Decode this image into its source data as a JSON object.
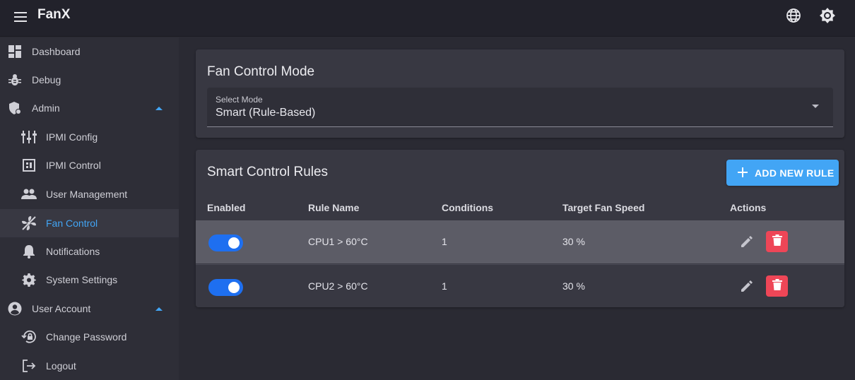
{
  "app": {
    "title": "FanX"
  },
  "topbar": {
    "icons": [
      "menu-icon",
      "globe-icon",
      "theme-brightness-icon"
    ]
  },
  "sidebar": {
    "items": [
      {
        "label": "Dashboard",
        "icon": "dashboard-icon"
      },
      {
        "label": "Debug",
        "icon": "bug-icon"
      },
      {
        "label": "Admin",
        "icon": "admin-shield-icon",
        "expanded": true
      },
      {
        "label": "IPMI Config",
        "icon": "sliders-icon"
      },
      {
        "label": "IPMI Control",
        "icon": "chip-icon"
      },
      {
        "label": "User Management",
        "icon": "people-icon"
      },
      {
        "label": "Fan Control",
        "icon": "fan-icon",
        "active": true
      },
      {
        "label": "Notifications",
        "icon": "bell-icon"
      },
      {
        "label": "System Settings",
        "icon": "gear-icon"
      },
      {
        "label": "User Account",
        "icon": "account-circle-icon",
        "expanded": true
      },
      {
        "label": "Change Password",
        "icon": "lock-reset-icon"
      },
      {
        "label": "Logout",
        "icon": "logout-icon"
      }
    ]
  },
  "mode_card": {
    "title": "Fan Control Mode",
    "select_label": "Select Mode",
    "select_value": "Smart (Rule-Based)"
  },
  "rules_card": {
    "title": "Smart Control Rules",
    "add_button": "ADD NEW RULE",
    "columns": [
      "Enabled",
      "Rule Name",
      "Conditions",
      "Target Fan Speed",
      "Actions"
    ],
    "rows": [
      {
        "enabled": true,
        "name": "CPU1 > 60°C",
        "conditions": "1",
        "speed": "30 %"
      },
      {
        "enabled": true,
        "name": "CPU2 > 60°C",
        "conditions": "1",
        "speed": "30 %"
      }
    ]
  },
  "colors": {
    "accent": "#42a5f5",
    "toggle": "#1e6ff0",
    "danger": "#ee4657"
  }
}
